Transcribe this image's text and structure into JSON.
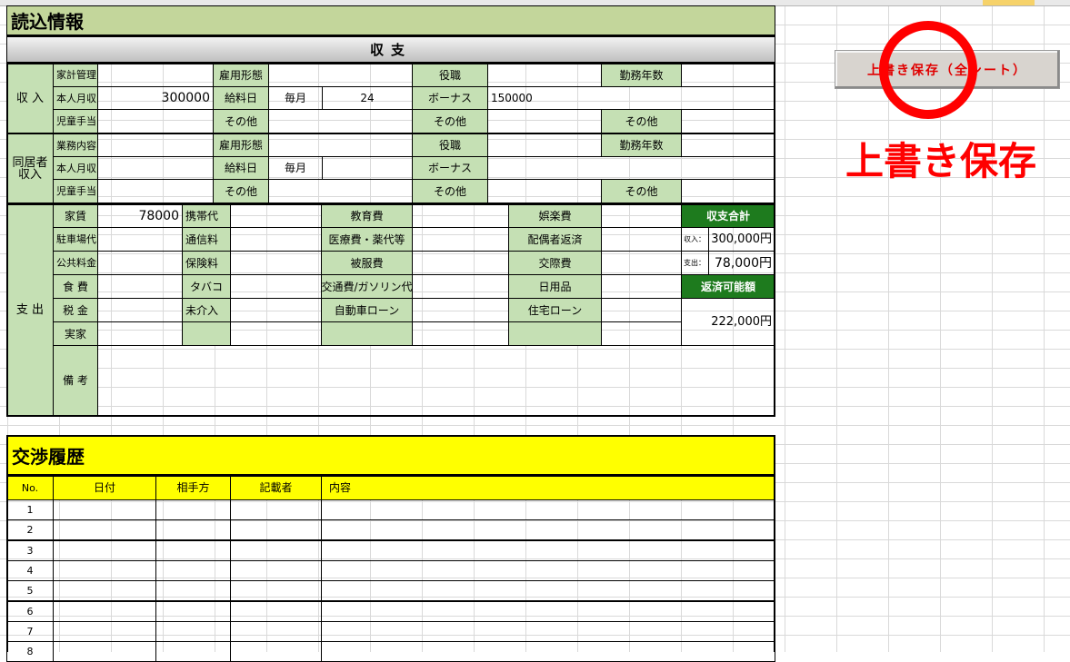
{
  "sheet": {
    "title": "読込情報",
    "section_header": "収支"
  },
  "income": {
    "label": "収 入",
    "rows": [
      {
        "c1": "家計管理",
        "v1": "",
        "c2": "雇用形態",
        "v2": "",
        "c3": "役職",
        "v3": "",
        "c4": "勤務年数",
        "v4": ""
      },
      {
        "c1": "本人月収",
        "v1": "300000",
        "c2": "給料日",
        "v2a": "毎月",
        "v2b": "24",
        "c3": "ボーナス",
        "v3": "150000"
      },
      {
        "c1": "児童手当",
        "v1": "",
        "c2": "その他",
        "v2": "",
        "c3": "その他",
        "v3": "",
        "c4": "その他",
        "v4": ""
      }
    ]
  },
  "cohabitant": {
    "label_line1": "同居者",
    "label_line2": "収入",
    "rows": [
      {
        "c1": "業務内容",
        "v1": "",
        "c2": "雇用形態",
        "v2": "",
        "c3": "役職",
        "v3": "",
        "c4": "勤務年数",
        "v4": ""
      },
      {
        "c1": "本人月収",
        "v1": "",
        "c2": "給料日",
        "v2a": "毎月",
        "v2b": "",
        "c3": "ボーナス",
        "v3": ""
      },
      {
        "c1": "児童手当",
        "v1": "",
        "c2": "その他",
        "v2": "",
        "c3": "その他",
        "v3": "",
        "c4": "その他",
        "v4": ""
      }
    ]
  },
  "expense": {
    "label": "支 出",
    "rows": [
      {
        "a": "家賃",
        "av": "78000",
        "b": "携帯代",
        "c": "教育費",
        "d": "娯楽費"
      },
      {
        "a": "駐車場代",
        "av": "",
        "b": "通信料",
        "c": "医療費・薬代等",
        "d": "配偶者返済"
      },
      {
        "a": "公共料金",
        "av": "",
        "b": "保険料",
        "c": "被服費",
        "d": "交際費"
      },
      {
        "a": "食 費",
        "av": "",
        "b": "タバコ",
        "c": "交通費/ガソリン代",
        "d": "日用品"
      },
      {
        "a": "税 金",
        "av": "",
        "b": "未介入",
        "c": "自動車ローン",
        "d": "住宅ローン"
      },
      {
        "a": "実家",
        "av": "",
        "b": "",
        "c": "",
        "d": ""
      }
    ],
    "remarks_label": "備 考"
  },
  "summary": {
    "total_header": "収支合計",
    "income_label": "収入：",
    "income_value": "300,000円",
    "expense_label": "支出：",
    "expense_value": "78,000円",
    "repay_header": "返済可能額",
    "repay_value": "222,000円"
  },
  "negotiation": {
    "title": "交渉履歴",
    "columns": [
      "No.",
      "日付",
      "相手方",
      "記載者",
      "内容"
    ],
    "rows": [
      "1",
      "2",
      "3",
      "4",
      "5",
      "6",
      "7",
      "8"
    ]
  },
  "controls": {
    "save_button_label": "上書き保存（全シート）",
    "annotation_text": "上書き保存"
  },
  "colors": {
    "title_green": "#c3d69b",
    "label_green": "#c5e0b4",
    "summary_green": "#1e7b1e",
    "negotiation_yellow": "#ffff00",
    "annotation_red": "#ff0000"
  }
}
